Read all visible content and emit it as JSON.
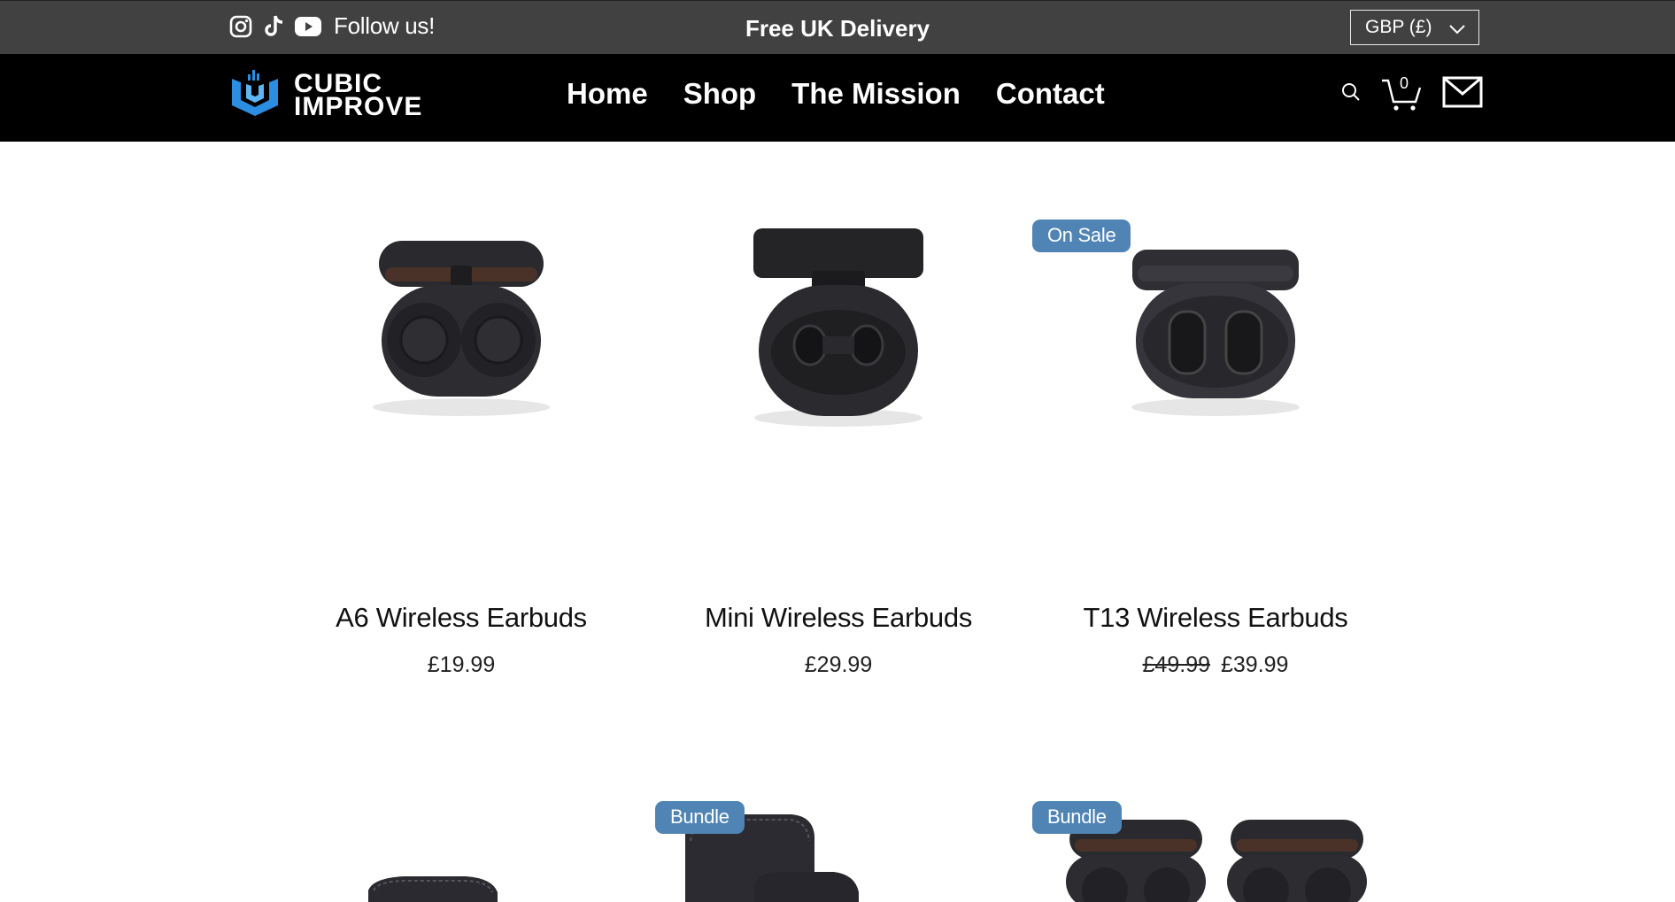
{
  "topbar": {
    "follow_label": "Follow us!",
    "delivery_label": "Free UK Delivery",
    "currency_label": "GBP (£)"
  },
  "nav": {
    "logo_line1": "CUBIC",
    "logo_line2": "IMPROVE",
    "menu": [
      {
        "label": "Home"
      },
      {
        "label": "Shop"
      },
      {
        "label": "The Mission"
      },
      {
        "label": "Contact"
      }
    ],
    "cart_count": "0"
  },
  "products": [
    {
      "name": "A6 Wireless Earbuds",
      "price": "£19.99"
    },
    {
      "name": "Mini Wireless Earbuds",
      "price": "£29.99"
    },
    {
      "name": "T13 Wireless Earbuds",
      "price": "£39.99",
      "old_price": "£49.99",
      "badge": "On Sale"
    }
  ],
  "row2_badges": [
    "Bundle",
    "Bundle"
  ],
  "colors": {
    "topbar": "#414141",
    "nav": "#000000",
    "badge": "#4f84b4"
  }
}
